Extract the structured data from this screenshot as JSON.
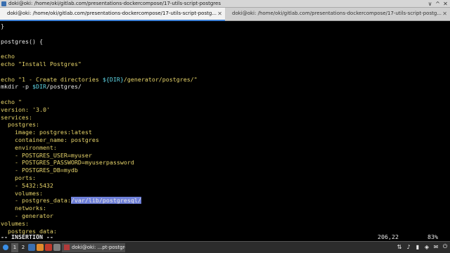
{
  "window": {
    "title": "doki@oki: /home/oki/gitlab.com/presentations-dockercompose/17-utils-script-postgres",
    "buttons": [
      "∨",
      "^",
      "✕"
    ]
  },
  "tabs": [
    {
      "label": "doki@oki: /home/oki/gitlab.com/presentations-dockercompose/17-utils-script-postg...",
      "active": true,
      "close": "✕"
    },
    {
      "label": "doki@oki: /home/oki/gitlab.com/presentations-dockercompose/17-utils-script-postg...",
      "active": false,
      "close": "✕"
    }
  ],
  "editor": {
    "lines": [
      [
        {
          "t": "}",
          "c": "white"
        }
      ],
      [
        {
          "t": "",
          "c": "white"
        }
      ],
      [
        {
          "t": "postgres() {",
          "c": "white"
        }
      ],
      [
        {
          "t": "",
          "c": "white"
        }
      ],
      [
        {
          "t": "echo",
          "c": "yellow"
        }
      ],
      [
        {
          "t": "echo ",
          "c": "yellow"
        },
        {
          "t": "\"Install Postgres\"",
          "c": "yellow"
        }
      ],
      [
        {
          "t": "",
          "c": "white"
        }
      ],
      [
        {
          "t": "echo ",
          "c": "yellow"
        },
        {
          "t": "\"1 - Create directories ",
          "c": "yellow"
        },
        {
          "t": "${DIR}",
          "c": "cyan"
        },
        {
          "t": "/generator/postgres/\"",
          "c": "yellow"
        }
      ],
      [
        {
          "t": "mkdir -p ",
          "c": "white"
        },
        {
          "t": "$DIR",
          "c": "cyan"
        },
        {
          "t": "/postgres/",
          "c": "white"
        }
      ],
      [
        {
          "t": "",
          "c": "white"
        }
      ],
      [
        {
          "t": "echo ",
          "c": "yellow"
        },
        {
          "t": "\"",
          "c": "yellow"
        }
      ],
      [
        {
          "t": "version: '3.0'",
          "c": "yellow"
        }
      ],
      [
        {
          "t": "services:",
          "c": "yellow"
        }
      ],
      [
        {
          "t": "  postgres:",
          "c": "yellow"
        }
      ],
      [
        {
          "t": "    image: postgres:latest",
          "c": "yellow"
        }
      ],
      [
        {
          "t": "    container_name: postgres",
          "c": "yellow"
        }
      ],
      [
        {
          "t": "    environment:",
          "c": "yellow"
        }
      ],
      [
        {
          "t": "    - POSTGRES_USER=myuser",
          "c": "yellow"
        }
      ],
      [
        {
          "t": "    - POSTGRES_PASSWORD=myuserpassword",
          "c": "yellow"
        }
      ],
      [
        {
          "t": "    - POSTGRES_DB=mydb",
          "c": "yellow"
        }
      ],
      [
        {
          "t": "    ports:",
          "c": "yellow"
        }
      ],
      [
        {
          "t": "    - 5432:5432",
          "c": "yellow"
        }
      ],
      [
        {
          "t": "    volumes:",
          "c": "yellow"
        }
      ],
      [
        {
          "t": "    - postgres_data:",
          "c": "yellow"
        },
        {
          "t": "/var/lib/postgresql/",
          "c": "sel"
        }
      ],
      [
        {
          "t": "    networks:",
          "c": "yellow"
        }
      ],
      [
        {
          "t": "    - generator",
          "c": "yellow"
        }
      ],
      [
        {
          "t": "volumes:",
          "c": "yellow"
        }
      ],
      [
        {
          "t": "  postgres_data:",
          "c": "yellow"
        }
      ]
    ]
  },
  "status": {
    "mode": "-- INSERTION --",
    "position": "206,22",
    "percent": "83%"
  },
  "taskbar": {
    "workspaces": [
      "1",
      "2"
    ],
    "task_label": "doki@oki: ...pt-postgres",
    "launcher_colors": [
      "#3a6fb0",
      "#e08a2c",
      "#c0392b",
      "#7f7f7f"
    ],
    "tray_icons": [
      "network-icon",
      "audio-icon",
      "battery-icon",
      "shield-icon",
      "chat-icon",
      "power-icon"
    ]
  }
}
